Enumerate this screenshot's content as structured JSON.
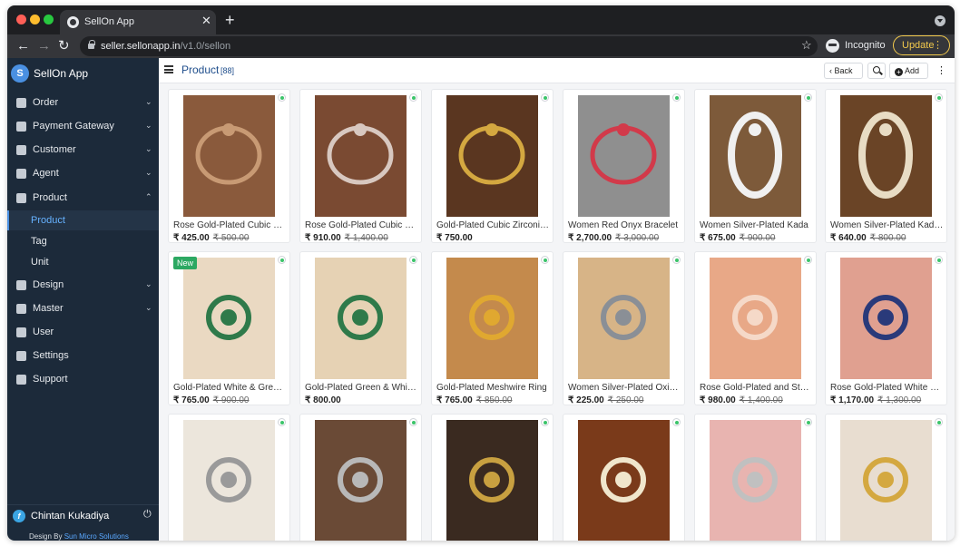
{
  "browser": {
    "tab_title": "SellOn App",
    "url_domain": "seller.sellonapp.in",
    "url_path": "/v1.0/sellon",
    "incognito_label": "Incognito",
    "update_label": "Update"
  },
  "sidebar": {
    "brand_initial": "S",
    "brand_name": "SellOn App",
    "items": [
      {
        "label": "Order",
        "icon": "cart-icon",
        "chevron": "⌄"
      },
      {
        "label": "Payment Gateway",
        "icon": "bank-icon",
        "chevron": "⌄"
      },
      {
        "label": "Customer",
        "icon": "user-icon",
        "chevron": "⌄"
      },
      {
        "label": "Agent",
        "icon": "users-icon",
        "chevron": "⌄"
      },
      {
        "label": "Product",
        "icon": "tag-icon",
        "chevron": "⌃"
      },
      {
        "label": "Design",
        "icon": "layout-icon",
        "chevron": "⌄"
      },
      {
        "label": "Master",
        "icon": "layers-icon",
        "chevron": "⌄"
      },
      {
        "label": "User",
        "icon": "user-icon"
      },
      {
        "label": "Settings",
        "icon": "sliders-icon"
      },
      {
        "label": "Support",
        "icon": "handshake-icon"
      }
    ],
    "sub_items": [
      {
        "label": "Product",
        "active": true
      },
      {
        "label": "Tag",
        "active": false
      },
      {
        "label": "Unit",
        "active": false
      }
    ],
    "user_name": "Chintan Kukadiya",
    "design_by_prefix": "Design By",
    "design_by_company": "Sun Micro Solutions"
  },
  "header": {
    "title": "Product",
    "count": "[88]",
    "back_label": "Back",
    "add_label": "Add"
  },
  "products": [
    {
      "name": "Rose Gold-Plated Cubic Zirconia Bangle",
      "price": "₹ 425.00",
      "mrp": "₹ 500.00",
      "new": false
    },
    {
      "name": "Rose Gold-Plated Cubic Zirconia Bracelet",
      "price": "₹ 910.00",
      "mrp": "₹ 1,400.00",
      "new": false
    },
    {
      "name": "Gold-Plated Cubic Zirconia Bracelet",
      "price": "₹ 750.00",
      "mrp": "",
      "new": false
    },
    {
      "name": "Women Red Onyx Bracelet",
      "price": "₹ 2,700.00",
      "mrp": "₹ 3,000.00",
      "new": false
    },
    {
      "name": "Women Silver-Plated Kada",
      "price": "₹ 675.00",
      "mrp": "₹ 900.00",
      "new": false
    },
    {
      "name": "Women Silver-Plated Kada Bracelet",
      "price": "₹ 640.00",
      "mrp": "₹ 800.00",
      "new": false
    },
    {
      "name": "Gold-Plated White & Green Ring",
      "price": "₹ 765.00",
      "mrp": "₹ 900.00",
      "new": true
    },
    {
      "name": "Gold-Plated Green & White Ring",
      "price": "₹ 800.00",
      "mrp": "",
      "new": false
    },
    {
      "name": "Gold-Plated Meshwire Ring",
      "price": "₹ 765.00",
      "mrp": "₹ 850.00",
      "new": false
    },
    {
      "name": "Women Silver-Plated Oxidised Ring",
      "price": "₹ 225.00",
      "mrp": "₹ 250.00",
      "new": false
    },
    {
      "name": "Rose Gold-Plated and Stone Ring",
      "price": "₹ 980.00",
      "mrp": "₹ 1,400.00",
      "new": false
    },
    {
      "name": "Rose Gold-Plated White Ring",
      "price": "₹ 1,170.00",
      "mrp": "₹ 1,300.00",
      "new": false
    },
    {
      "name": "",
      "price": "",
      "mrp": "",
      "new": false
    },
    {
      "name": "",
      "price": "",
      "mrp": "",
      "new": false
    },
    {
      "name": "",
      "price": "",
      "mrp": "",
      "new": false
    },
    {
      "name": "",
      "price": "",
      "mrp": "",
      "new": false
    },
    {
      "name": "",
      "price": "",
      "mrp": "",
      "new": false
    },
    {
      "name": "",
      "price": "",
      "mrp": "",
      "new": false
    }
  ],
  "new_badge_label": "New",
  "colors": {
    "sidebar_bg": "#1c2a3a",
    "accent": "#4a90e2",
    "active_text": "#66b2ff",
    "status_green": "#3cc46a",
    "new_badge": "#2ca862"
  }
}
